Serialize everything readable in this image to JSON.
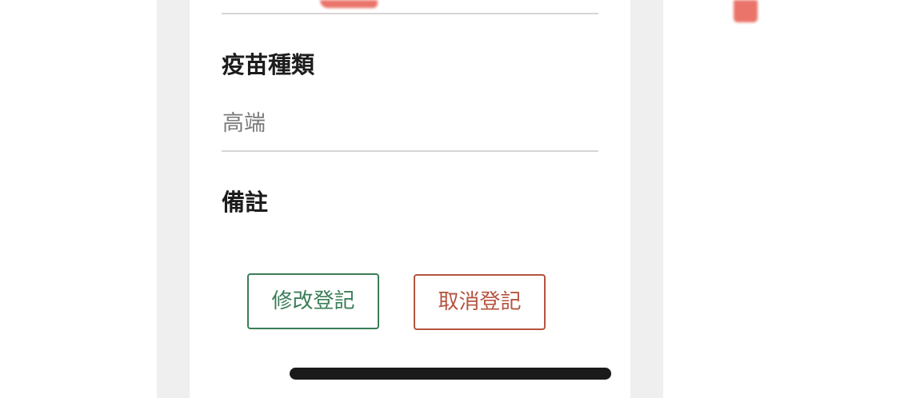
{
  "form": {
    "vaccine_type": {
      "label": "疫苗種類",
      "value": "高端"
    },
    "remarks": {
      "label": "備註",
      "value": ""
    }
  },
  "actions": {
    "edit_label": "修改登記",
    "cancel_label": "取消登記"
  },
  "colors": {
    "edit_accent": "#3a7d57",
    "cancel_accent": "#b4543f",
    "redaction": "#e8655a"
  }
}
